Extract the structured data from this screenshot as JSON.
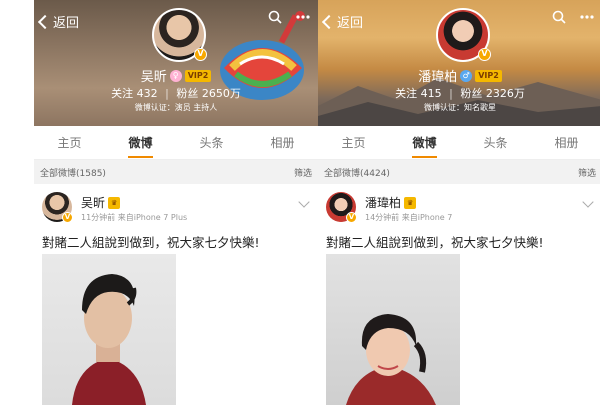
{
  "left_profile": {
    "back_label": "返回",
    "name": "吴昕",
    "vip_tag": "VIP2",
    "stats": {
      "follow_label": "关注",
      "follow_count": "432",
      "fans_label": "粉丝",
      "fans_count": "2650万"
    },
    "certification": "微博认证：演员 主持人",
    "tabs": [
      "主页",
      "微博",
      "头条",
      "相册"
    ],
    "active_tab": "微博",
    "all_weibo": "全部微博(1585)",
    "filter_label": "筛选",
    "post": {
      "author": "吴昕",
      "meta": "11分钟前  来自iPhone 7 Plus",
      "text": "對賭二人組說到做到，祝大家七夕快樂!"
    }
  },
  "right_profile": {
    "back_label": "返回",
    "name": "潘瑋柏",
    "vip_tag": "VIP2",
    "stats": {
      "follow_label": "关注",
      "follow_count": "415",
      "fans_label": "粉丝",
      "fans_count": "2326万"
    },
    "certification": "微博认证：知名歌星",
    "tabs": [
      "主页",
      "微博",
      "头条",
      "相册"
    ],
    "active_tab": "微博",
    "all_weibo": "全部微博(4424)",
    "filter_label": "筛选",
    "post": {
      "author": "潘瑋柏",
      "meta": "14分钟前  来自iPhone 7",
      "text": "對賭二人組說到做到，祝大家七夕快樂!"
    }
  },
  "icons": [
    "chevron-left-icon",
    "search-icon",
    "more-icon",
    "vip-crown-icon",
    "verified-badge-icon",
    "chevron-down-icon"
  ],
  "colors": {
    "accent": "#f08a00",
    "vip": "#f5b800",
    "verified": "#f7a800"
  }
}
